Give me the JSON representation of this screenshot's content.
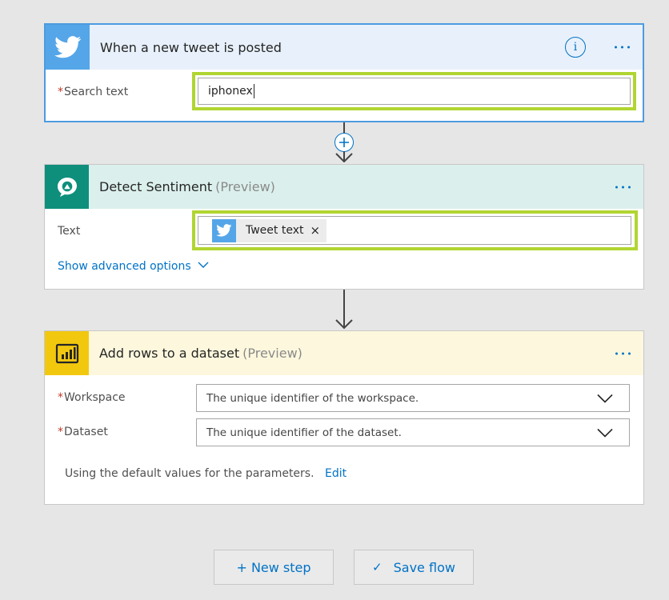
{
  "twitter_card": {
    "title": "When a new tweet is posted",
    "header_color": "#e8f1fb",
    "icon_color": "#4b9ae0",
    "icon": "twitter-bird-icon",
    "info_icon_glyph": "i",
    "fields": {
      "search_text_label": "Search text",
      "search_text_value": "iphonex"
    }
  },
  "sentiment_card": {
    "title": "Detect Sentiment",
    "preview_label": "(Preview)",
    "header_color": "#dbf0ec",
    "icon_color": "#0e8f7c",
    "icon": "cognitive-services-icon",
    "fields": {
      "text_label": "Text",
      "token_label": "Tweet text",
      "token_remove_glyph": "×"
    },
    "advanced_options_label": "Show advanced options"
  },
  "powerbi_card": {
    "title": "Add rows to a dataset",
    "preview_label": "(Preview)",
    "header_color": "#fdf8dd",
    "icon_color": "#f2c80f",
    "icon": "power-bi-icon",
    "fields": {
      "workspace_label": "Workspace",
      "workspace_placeholder": "The unique identifier of the workspace.",
      "dataset_label": "Dataset",
      "dataset_placeholder": "The unique identifier of the dataset."
    },
    "defaults_note": "Using the default values for the parameters.",
    "edit_label": "Edit"
  },
  "required_marker": "*",
  "footer": {
    "new_step_label": "+ New step",
    "save_flow_label": "Save flow",
    "save_icon_glyph": "✓"
  },
  "colors": {
    "accent_blue": "#0072c6",
    "highlight_green": "#b1d531",
    "required_red": "#c0392b"
  }
}
